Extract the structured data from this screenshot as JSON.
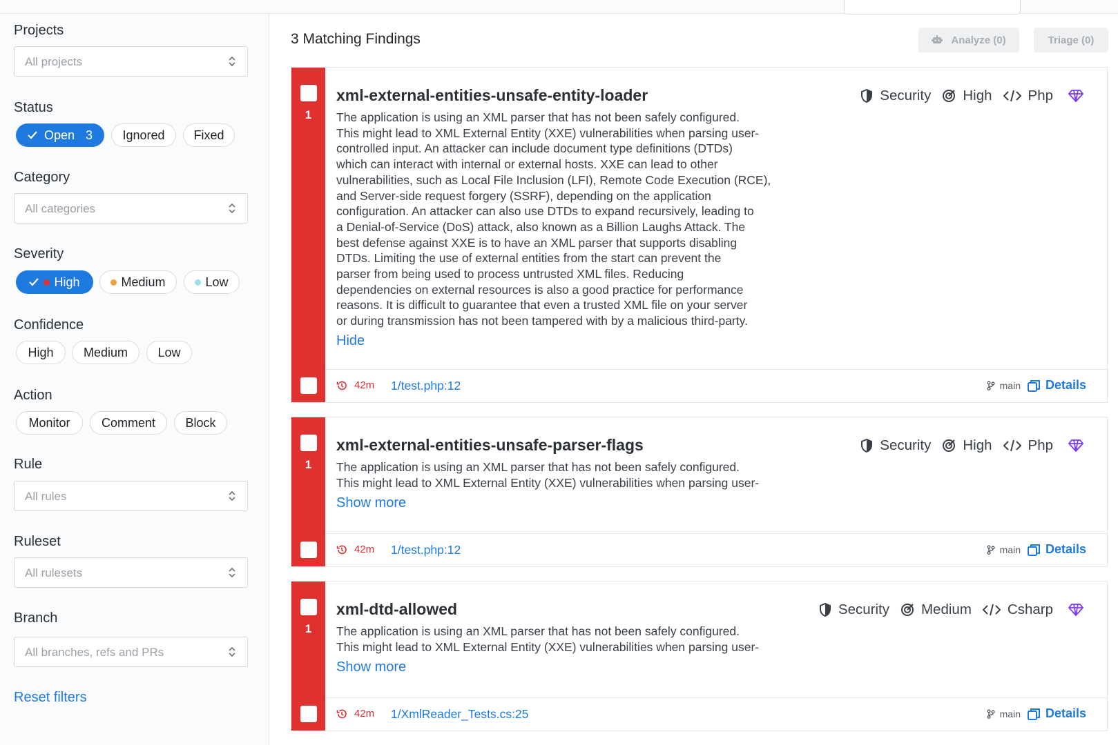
{
  "sidebar": {
    "projects": {
      "title": "Projects",
      "placeholder": "All projects"
    },
    "status": {
      "title": "Status",
      "options": [
        {
          "label": "Open",
          "count": "3"
        },
        {
          "label": "Ignored"
        },
        {
          "label": "Fixed"
        }
      ]
    },
    "category": {
      "title": "Category",
      "placeholder": "All categories"
    },
    "severity": {
      "title": "Severity",
      "options": [
        {
          "label": "High",
          "dot_color": "#e03131"
        },
        {
          "label": "Medium",
          "dot_color": "#f0a040"
        },
        {
          "label": "Low",
          "dot_color": "#9fe0e6"
        }
      ]
    },
    "confidence": {
      "title": "Confidence",
      "options": [
        "High",
        "Medium",
        "Low"
      ]
    },
    "action": {
      "title": "Action",
      "options": [
        "Monitor",
        "Comment",
        "Block"
      ]
    },
    "rule": {
      "title": "Rule",
      "placeholder": "All rules"
    },
    "ruleset": {
      "title": "Ruleset",
      "placeholder": "All rulesets"
    },
    "branch": {
      "title": "Branch",
      "placeholder": "All branches, refs and PRs"
    },
    "reset_label": "Reset filters"
  },
  "main": {
    "heading": "3 Matching Findings",
    "analyze_label": "Analyze (0)",
    "triage_label": "Triage (0)"
  },
  "findings": [
    {
      "count": "1",
      "title": "xml-external-entities-unsafe-entity-loader",
      "category": "Security",
      "confidence": "High",
      "language": "Php",
      "description_lines": [
        "The application is using an XML parser that has not been safely configured.",
        "This might lead to XML External Entity (XXE) vulnerabilities when parsing user-",
        "controlled input. An attacker can include document type definitions (DTDs)",
        "which can interact with internal or external hosts. XXE can lead to other",
        "vulnerabilities, such as Local File Inclusion (LFI), Remote Code Execution (RCE),",
        "and Server-side request forgery (SSRF), depending on the application",
        "configuration. An attacker can also use DTDs to expand recursively, leading to",
        "a Denial-of-Service (DoS) attack, also known as a Billion Laughs Attack. The",
        "best defense against XXE is to have an XML parser that supports disabling",
        "DTDs. Limiting the use of external entities from the start can prevent the",
        "parser from being used to process untrusted XML files. Reducing",
        "dependencies on external resources is also a good practice for performance",
        "reasons. It is difficult to guarantee that even a trusted XML file on your server",
        "or during transmission has not been tampered with by a malicious third-party."
      ],
      "toggle_label": "Hide",
      "age": "42m",
      "location": "1/test.php:12",
      "branch": "main",
      "details_label": "Details"
    },
    {
      "count": "1",
      "title": "xml-external-entities-unsafe-parser-flags",
      "category": "Security",
      "confidence": "High",
      "language": "Php",
      "description_lines": [
        "The application is using an XML parser that has not been safely configured.",
        "This might lead to XML External Entity (XXE) vulnerabilities when parsing user-"
      ],
      "toggle_label": "Show more",
      "age": "42m",
      "location": "1/test.php:12",
      "branch": "main",
      "details_label": "Details"
    },
    {
      "count": "1",
      "title": "xml-dtd-allowed",
      "category": "Security",
      "confidence": "Medium",
      "language": "Csharp",
      "description_lines": [
        "The application is using an XML parser that has not been safely configured.",
        "This might lead to XML External Entity (XXE) vulnerabilities when parsing user-"
      ],
      "toggle_label": "Show more",
      "age": "42m",
      "location": "1/XmlReader_Tests.cs:25",
      "branch": "main",
      "details_label": "Details"
    }
  ]
}
